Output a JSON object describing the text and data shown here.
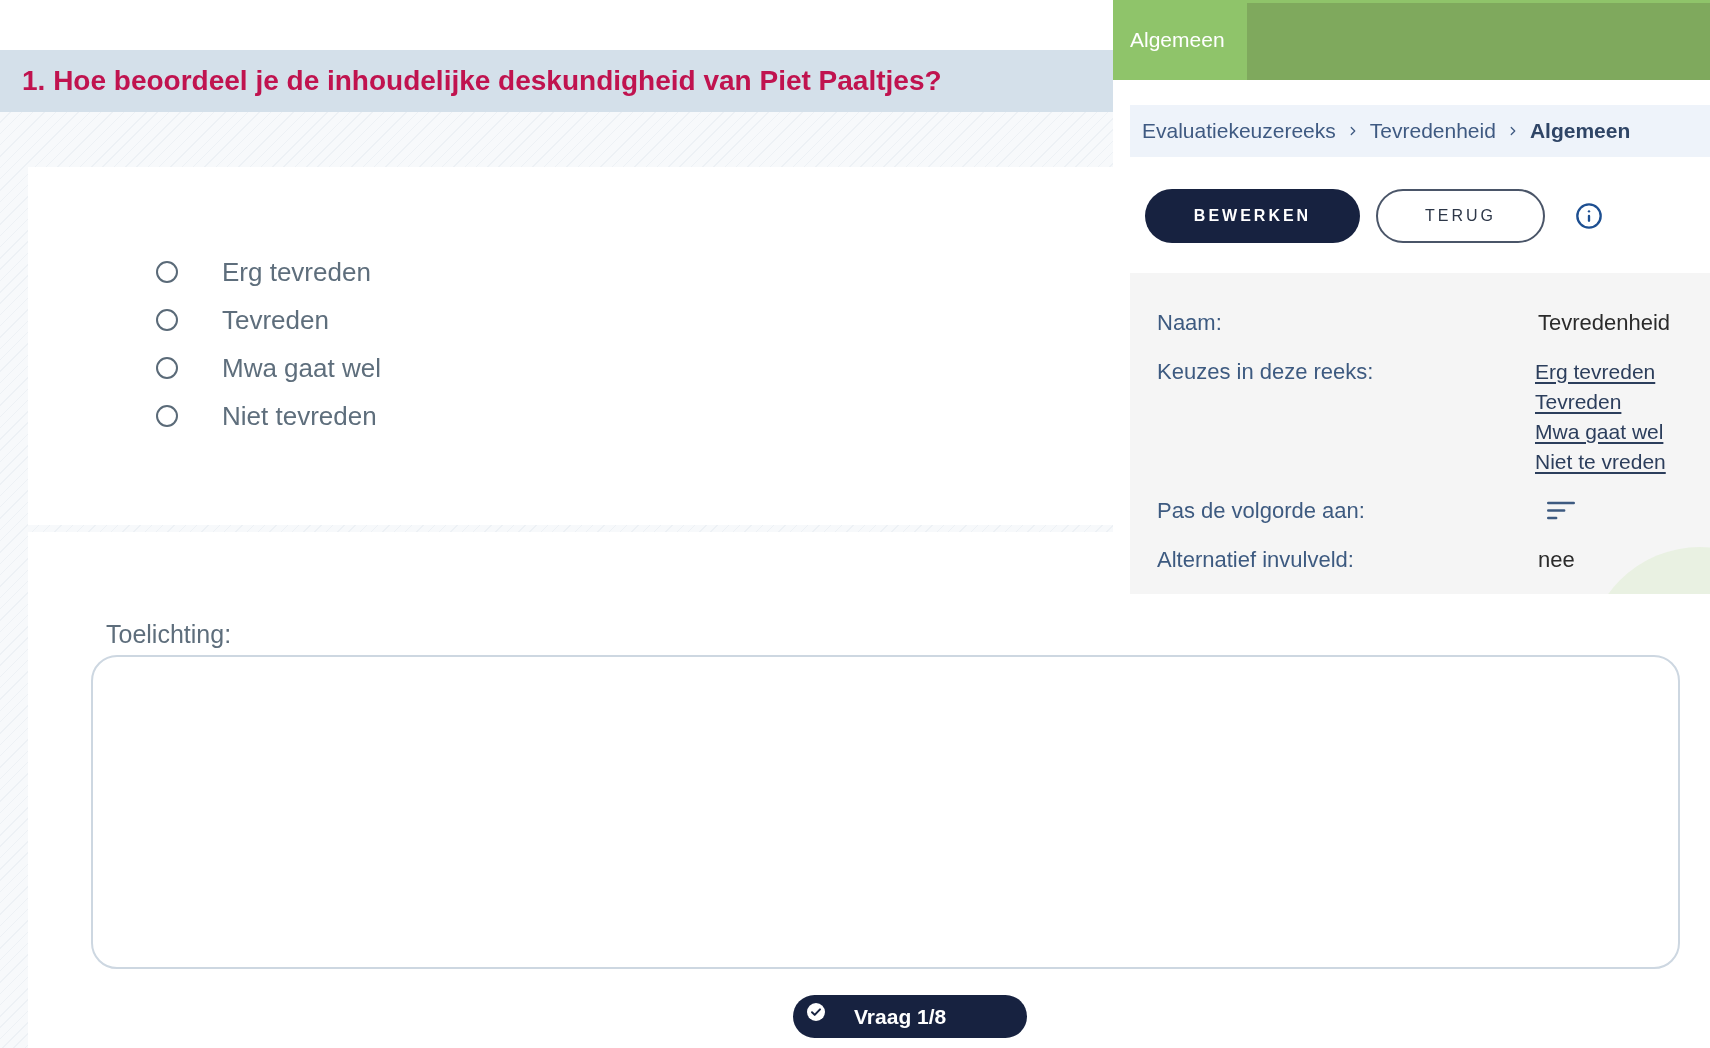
{
  "question": {
    "title": "1. Hoe beoordeel je de inhoudelijke deskundigheid van Piet Paaltjes?"
  },
  "options": [
    {
      "label": "Erg tevreden",
      "selected": false
    },
    {
      "label": "Tevreden",
      "selected": false
    },
    {
      "label": "Mwa gaat wel",
      "selected": false
    },
    {
      "label": "Niet tevreden",
      "selected": false
    }
  ],
  "comment": {
    "label": "Toelichting:"
  },
  "navigator": {
    "label": "Vraag 1/8"
  },
  "panel": {
    "tabs": [
      {
        "label": "Algemeen",
        "selected": true
      }
    ],
    "breadcrumb": [
      {
        "label": "Evaluatiekeuzereeks",
        "current": false
      },
      {
        "label": "Tevredenheid",
        "current": false
      },
      {
        "label": "Algemeen",
        "current": true
      }
    ],
    "buttons": [
      {
        "label": "BEWERKEN",
        "kind": "primary"
      },
      {
        "label": "TERUG",
        "kind": "secondary"
      }
    ],
    "details": [
      {
        "kind": "text",
        "label": "Naam:",
        "value": "Tevredenheid"
      },
      {
        "kind": "links",
        "label": "Keuzes in deze reeks:",
        "links": [
          "Erg tevreden",
          "Tevreden",
          "Mwa gaat wel",
          "Niet te vreden"
        ]
      },
      {
        "kind": "sort",
        "label": "Pas de volgorde aan:"
      },
      {
        "kind": "text",
        "label": "Alternatief invulveld:",
        "value": "nee"
      }
    ]
  }
}
